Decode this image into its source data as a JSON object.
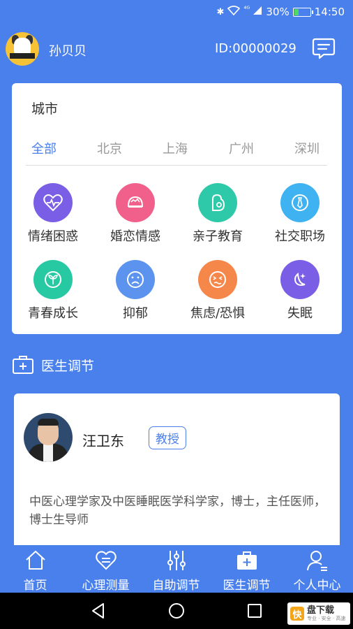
{
  "status_bar": {
    "signal": "⁴ᴳ",
    "battery_percent": "30%",
    "battery_level": 0.3,
    "time": "14:50"
  },
  "header": {
    "username": "孙贝贝",
    "user_id": "ID:00000029"
  },
  "city_section": {
    "title": "城市",
    "tabs": [
      "全部",
      "北京",
      "上海",
      "广州",
      "深圳"
    ],
    "active_tab": "全部"
  },
  "categories": [
    {
      "label": "情绪困惑",
      "icon": "heart-pulse-icon",
      "color": "#7a5ee6"
    },
    {
      "label": "婚恋情感",
      "icon": "rings-icon",
      "color": "#f0608a"
    },
    {
      "label": "亲子教育",
      "icon": "mother-child-icon",
      "color": "#2ec9a8"
    },
    {
      "label": "社交职场",
      "icon": "tie-icon",
      "color": "#3fb2f2"
    },
    {
      "label": "青春成长",
      "icon": "sprout-icon",
      "color": "#27c9a3"
    },
    {
      "label": "抑郁",
      "icon": "sad-face-icon",
      "color": "#5b93ee"
    },
    {
      "label": "焦虑/恐惧",
      "icon": "anxious-face-icon",
      "color": "#f5874a"
    },
    {
      "label": "失眠",
      "icon": "moon-stars-icon",
      "color": "#7a5ee6"
    }
  ],
  "doctor_section": {
    "title": "医生调节"
  },
  "doctor": {
    "name": "汪卫东",
    "title_badge": "教授",
    "description": "中医心理学家及中医睡眠医学科学家，博士，主任医师，博士生导师"
  },
  "bottom_nav": [
    {
      "label": "首页",
      "icon": "home-icon"
    },
    {
      "label": "心理测量",
      "icon": "heart-test-icon"
    },
    {
      "label": "自助调节",
      "icon": "sliders-icon"
    },
    {
      "label": "医生调节",
      "icon": "medical-kit-icon"
    },
    {
      "label": "个人中心",
      "icon": "user-icon"
    }
  ],
  "watermark": {
    "logo": "快",
    "main": "盘下载",
    "sub": "专业 · 安全 · 高速"
  },
  "colors": {
    "primary": "#4a80ec",
    "card": "#ffffff"
  }
}
